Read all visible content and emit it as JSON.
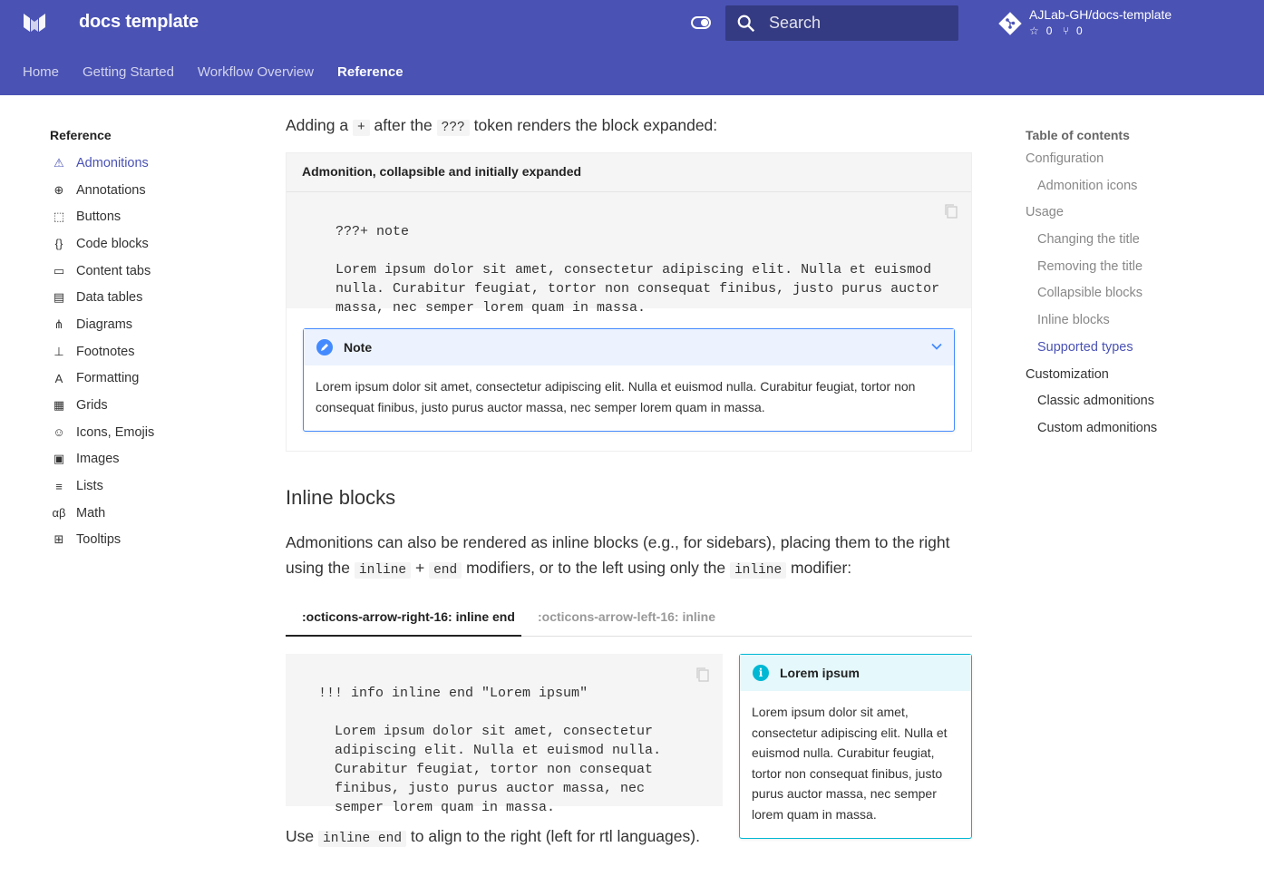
{
  "header": {
    "site_title": "docs template",
    "search_placeholder": "Search",
    "repo_name": "AJLab-GH/docs-template",
    "repo_stars": "0",
    "repo_forks": "0",
    "nav": [
      "Home",
      "Getting Started",
      "Workflow Overview",
      "Reference"
    ],
    "active_nav": "Reference",
    "color": "#4a52b4"
  },
  "sidebar": {
    "heading": "Reference",
    "items": [
      {
        "label": "Admonitions",
        "icon": "alert-triangle-icon",
        "active": true
      },
      {
        "label": "Annotations",
        "icon": "plus-circle-icon"
      },
      {
        "label": "Buttons",
        "icon": "cursor-click-icon"
      },
      {
        "label": "Code blocks",
        "icon": "code-braces-icon"
      },
      {
        "label": "Content tabs",
        "icon": "tab-icon"
      },
      {
        "label": "Data tables",
        "icon": "table-edit-icon"
      },
      {
        "label": "Diagrams",
        "icon": "graph-icon"
      },
      {
        "label": "Footnotes",
        "icon": "format-align-bottom-icon"
      },
      {
        "label": "Formatting",
        "icon": "format-font-icon"
      },
      {
        "label": "Grids",
        "icon": "grid-icon"
      },
      {
        "label": "Icons, Emojis",
        "icon": "emoticon-icon"
      },
      {
        "label": "Images",
        "icon": "image-icon"
      },
      {
        "label": "Lists",
        "icon": "list-icon"
      },
      {
        "label": "Math",
        "icon": "alpha-beta-icon"
      },
      {
        "label": "Tooltips",
        "icon": "tooltip-plus-icon"
      }
    ]
  },
  "toc": {
    "heading": "Table of contents",
    "items": [
      {
        "label": "Configuration",
        "level": 1,
        "style": "muted"
      },
      {
        "label": "Admonition icons",
        "level": 2,
        "style": "muted"
      },
      {
        "label": "Usage",
        "level": 1,
        "style": "muted"
      },
      {
        "label": "Changing the title",
        "level": 2,
        "style": "muted"
      },
      {
        "label": "Removing the title",
        "level": 2,
        "style": "muted"
      },
      {
        "label": "Collapsible blocks",
        "level": 2,
        "style": "muted"
      },
      {
        "label": "Inline blocks",
        "level": 2,
        "style": "muted"
      },
      {
        "label": "Supported types",
        "level": 2,
        "style": "active"
      },
      {
        "label": "Customization",
        "level": 1,
        "style": "dark"
      },
      {
        "label": "Classic admonitions",
        "level": 2,
        "style": "dark"
      },
      {
        "label": "Custom admonitions",
        "level": 2,
        "style": "dark"
      }
    ]
  },
  "main": {
    "intro": {
      "before": "Adding a",
      "code1": "+",
      "middle": "after the",
      "code2": "???",
      "after": "token renders the block expanded:"
    },
    "example": {
      "title": "Admonition, collapsible and initially expanded",
      "code": "???+ note\n\n    Lorem ipsum dolor sit amet, consectetur adipiscing elit. Nulla et euismod\n    nulla. Curabitur feugiat, tortor non consequat finibus, justo purus auctor\n    massa, nec semper lorem quam in massa.",
      "note_title": "Note",
      "note_body": "Lorem ipsum dolor sit amet, consectetur adipiscing elit. Nulla et euismod nulla. Curabitur feugiat, tortor non consequat finibus, justo purus auctor massa, nec semper lorem quam in massa."
    },
    "inline_heading": "Inline blocks",
    "inline_para": {
      "text1": "Admonitions can also be rendered as inline blocks (e.g., for sidebars), placing them to the right using the",
      "code1": "inline",
      "plus": "+",
      "code2": "end",
      "text2": "modifiers, or to the left using only the",
      "code3": "inline",
      "text3": "modifier:"
    },
    "tabs": [
      ":octicons-arrow-right-16: inline end",
      ":octicons-arrow-left-16: inline"
    ],
    "code2": "!!! info inline end \"Lorem ipsum\"\n\n    Lorem ipsum dolor sit amet, consectetur\n    adipiscing elit. Nulla et euismod nulla.\n    Curabitur feugiat, tortor non consequat\n    finibus, justo purus auctor massa, nec\n    semper lorem quam in massa.",
    "info_title": "Lorem ipsum",
    "info_body": "Lorem ipsum dolor sit amet, consectetur adipiscing elit. Nulla et euismod nulla. Curabitur feugiat, tortor non consequat finibus, justo purus auctor massa, nec semper lorem quam in massa.",
    "outro": {
      "before": "Use",
      "code": "inline end",
      "after": "to align to the right (left for rtl languages)."
    }
  }
}
